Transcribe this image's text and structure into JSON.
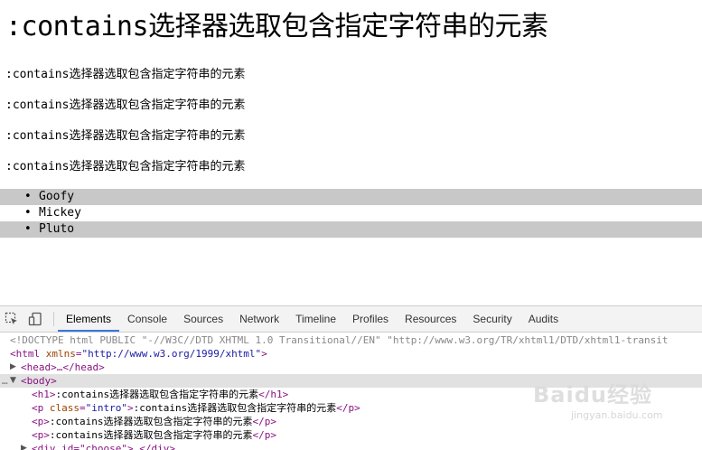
{
  "page": {
    "heading": ":contains选择器选取包含指定字符串的元素",
    "paragraphs": [
      ":contains选择器选取包含指定字符串的元素",
      ":contains选择器选取包含指定字符串的元素",
      ":contains选择器选取包含指定字符串的元素",
      ":contains选择器选取包含指定字符串的元素"
    ],
    "list_items": [
      "Goofy",
      "Mickey",
      "Pluto"
    ]
  },
  "devtools": {
    "icons": [
      "inspect-element-icon",
      "device-mode-icon"
    ],
    "tabs": [
      "Elements",
      "Console",
      "Sources",
      "Network",
      "Timeline",
      "Profiles",
      "Resources",
      "Security",
      "Audits"
    ],
    "active_tab": "Elements",
    "dom": {
      "doctype": "<!DOCTYPE html PUBLIC \"-//W3C//DTD XHTML 1.0 Transitional//EN\" \"http://www.w3.org/TR/xhtml1/DTD/xhtml1-transit",
      "html_open_tag": "<html",
      "html_attr": "xmlns",
      "html_attr_value": "\"http://www.w3.org/1999/xhtml\"",
      "head_collapsed": "<head>…</head>",
      "body_open": "<body>",
      "h1_text": ":contains选择器选取包含指定字符串的元素",
      "p_class_attr": "class",
      "p_class_value": "\"intro\"",
      "p1_text": ":contains选择器选取包含指定字符串的元素",
      "p2_text": ":contains选择器选取包含指定字符串的元素",
      "p3_text": ":contains选择器选取包含指定字符串的元素",
      "div_partial": "<div id=\"choose\">…</div>"
    }
  },
  "watermark": {
    "main": "Baidu经验",
    "sub": "jingyan.baidu.com"
  }
}
